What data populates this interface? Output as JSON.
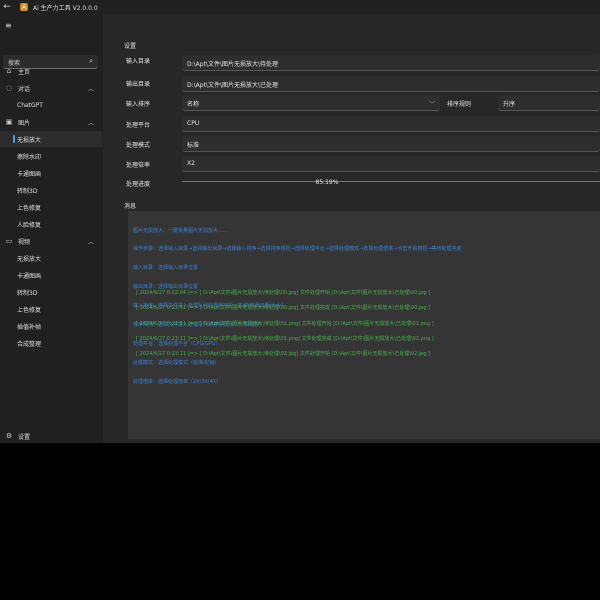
{
  "app": {
    "title": "Ai 生产力工具 V2.0.0.0"
  },
  "search": {
    "placeholder": "搜索"
  },
  "sidebar": {
    "home": "主页",
    "dialog": "对话",
    "chatgpt": "ChatGPT",
    "image": "图片",
    "image_items": [
      "无损放大",
      "擦除水印",
      "卡通图画",
      "转制3D",
      "上色修复",
      "人脸修复"
    ],
    "video": "视频",
    "video_items": [
      "无损放大",
      "卡通图画",
      "转制3D",
      "上色修复",
      "插值补帧",
      "合成整理"
    ],
    "settings": "设置"
  },
  "settings": {
    "title": "设置",
    "input_dir_label": "输入目录",
    "input_dir_value": "D:\\Apt\\文件\\图片无损放大\\待处理",
    "output_dir_label": "输出目录",
    "output_dir_value": "D:\\Apt\\文件\\图片无损放大\\已处理",
    "input_sort_label": "输入排序",
    "input_sort_value": "名称",
    "sort_rule_label": "排序规则",
    "sort_rule_value": "升序",
    "platform_label": "处理平台",
    "platform_value": "CPU",
    "mode_label": "处理模式",
    "mode_value": "标准",
    "ratio_label": "处理倍率",
    "ratio_value": "X2",
    "progress_label": "处理进度",
    "progress_value": "85.19%",
    "progress_fraction": 0.8519
  },
  "messages": {
    "title": "消息",
    "info_lines": [
      "图片无损放大：一键批量图片无损放大......",
      "操作步骤：选择输入目录→选择输出目录→选择输入排序→选择排序规则→选择处理平台→选择处理模式→选择处理倍率→点击开始按钮→等待处理完成",
      "输入目录：选择输入目录位置",
      "输出目录：选择输出目录位置",
      "输入排序：选择文件进入处理队列的排序字段（名称/修改日期/大小）",
      "排序规则：选择文件进入处理队列的排序规则（升序/降序）",
      "处理平台：选择处理平台（CPU/GPU）",
      "处理模式：选择处理模式（标准/动画）",
      "处理倍率：选择处理倍率（2X/3X/4X）"
    ],
    "logs": [
      "[ 2024/6/27 0:22:04 ]=> [ D:\\Apt\\文件\\图片无损放大\\待处理\\00.jpg] 文件处理开始 [D:\\Apt\\文件\\图片无损放大\\已处理\\00.jpg ]",
      "[ 2024/6/27 0:22:51 ]=> [ D:\\Apt\\文件\\图片无损放大\\待处理\\00.jpg] 文件处理完成 [D:\\Apt\\文件\\图片无损放大\\已处理\\00.jpg ]",
      "[ 2024/6/27 0:22:51 ]=> [ D:\\Apt\\文件\\图片无损放大\\待处理\\01.png] 文件处理开始 [D:\\Apt\\文件\\图片无损放大\\已处理\\01.png ]",
      "[ 2024/6/27 0:23:11 ]=> [ D:\\Apt\\文件\\图片无损放大\\待处理\\01.png] 文件处理完成 [D:\\Apt\\文件\\图片无损放大\\已处理\\01.png ]",
      "[ 2024/6/27 0:23:11 ]=> [ D:\\Apt\\文件\\图片无损放大\\待处理\\02.jpg] 文件处理开始 [D:\\Apt\\文件\\图片无损放大\\已处理\\02.jpg ]"
    ]
  },
  "colors": {
    "accent": "#4ca0e0",
    "info_text": "#3b82d6",
    "log_text": "#4caf50",
    "progress": "#4a7fd0"
  }
}
